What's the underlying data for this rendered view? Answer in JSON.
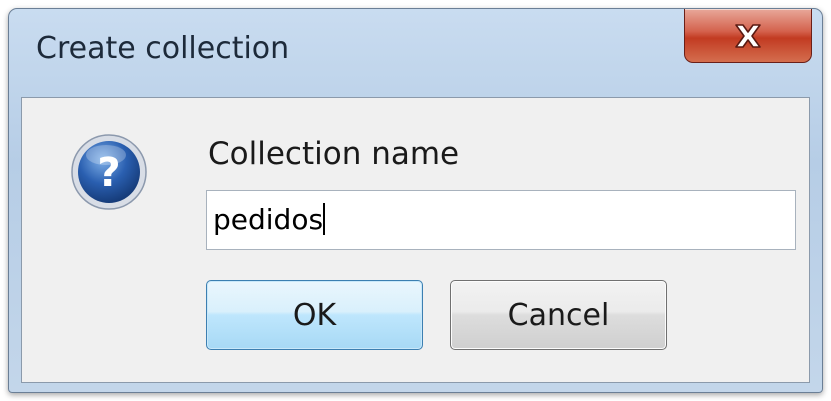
{
  "window": {
    "title": "Create collection"
  },
  "dialog": {
    "icon": "question-icon",
    "label": "Collection name",
    "input_value": "pedidos",
    "ok_label": "OK",
    "cancel_label": "Cancel"
  },
  "colors": {
    "ok_border": "#3c7fb1",
    "close_red": "#c23b22",
    "frame_blue": "#b6cde6"
  }
}
